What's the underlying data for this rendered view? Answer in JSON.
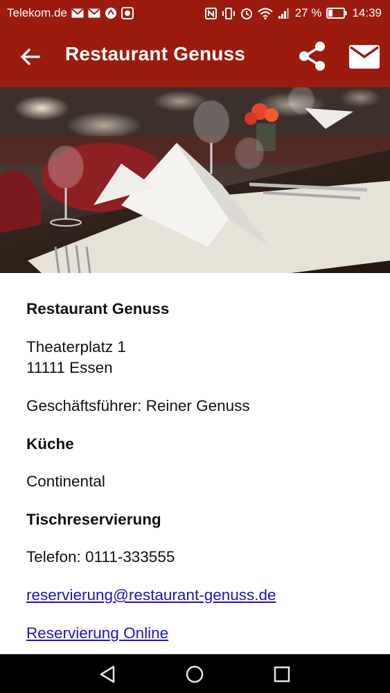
{
  "status_bar": {
    "carrier": "Telekom.de",
    "battery_percent": "27 %",
    "time": "14:39",
    "icons": [
      "mail-icon",
      "mail-icon",
      "sync-icon",
      "app-icon",
      "nfc-icon",
      "vibrate-icon",
      "alarm-icon",
      "wifi-icon",
      "signal-icon",
      "battery-icon"
    ]
  },
  "app_bar": {
    "title": "Restaurant Genuss",
    "icons": [
      "back-arrow-icon",
      "share-icon",
      "mail-icon"
    ],
    "color": "#9b1c0f"
  },
  "hero": {
    "description_icon": "restaurant-table-photo"
  },
  "details": {
    "name": "Restaurant Genuss",
    "street": "Theaterplatz 1",
    "city": "11111 Essen",
    "manager": "Geschäftsführer: Reiner Genuss",
    "kitchen_heading": "Küche",
    "kitchen_value": "Continental",
    "reservation_heading": "Tischreservierung",
    "phone": "Telefon:  0111-333555",
    "email": "reservierung@restaurant-genuss.de",
    "online_link": "Reservierung Online"
  },
  "colors": {
    "accent": "#9b1c0f",
    "link": "#1a14c8"
  },
  "nav_bar": {
    "icons": [
      "back-triangle-icon",
      "home-circle-icon",
      "recents-square-icon"
    ]
  }
}
